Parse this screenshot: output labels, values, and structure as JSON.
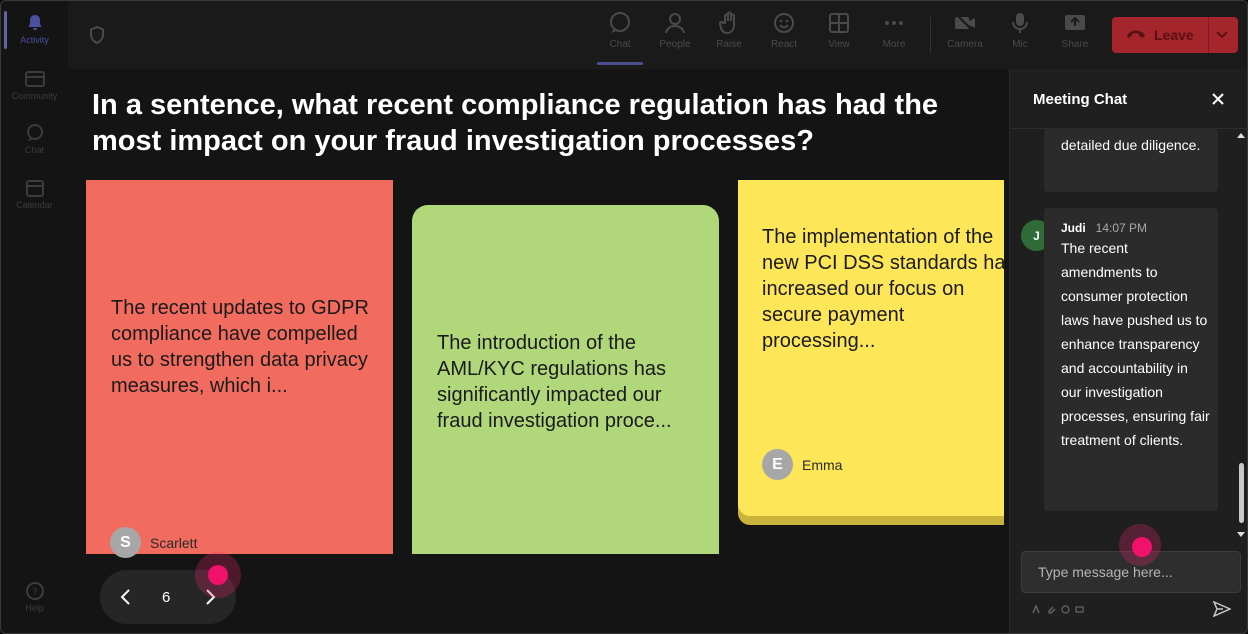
{
  "rail": {
    "items": [
      {
        "label": "Activity",
        "active": true
      },
      {
        "label": "Community"
      },
      {
        "label": "Chat"
      },
      {
        "label": "Calendar"
      }
    ],
    "help": "Help"
  },
  "toolbar": {
    "chat": "Chat",
    "people": "People",
    "raise": "Raise",
    "react": "React",
    "view": "View",
    "more": "More",
    "camera": "Camera",
    "mic": "Mic",
    "share": "Share",
    "leave": "Leave"
  },
  "stage": {
    "question": "In a sentence, what recent compliance regulation has had the most impact on your fraud investigation processes?",
    "cards": [
      {
        "text": "The recent updates to GDPR compliance have compelled us to strengthen data privacy measures, which i...",
        "author": "Scarlett",
        "initial": "S",
        "color": "#f26b5f"
      },
      {
        "text": "The introduction of the AML/KYC regulations has significantly impacted our fraud investigation proce...",
        "color": "#b0d77a"
      },
      {
        "text": "The implementation of the new PCI DSS standards has increased our focus on secure payment processing...",
        "author": "Emma",
        "initial": "E",
        "color": "#fee659"
      }
    ],
    "pager": {
      "page": "6"
    }
  },
  "chat": {
    "title": "Meeting Chat",
    "messages": [
      {
        "text": "detailed due diligence."
      },
      {
        "author": "Judi",
        "initial": "J",
        "time": "14:07 PM",
        "text": "The recent amendments to consumer protection laws have pushed us to enhance transparency and accountability in our investigation processes, ensuring fair treatment of clients."
      }
    ],
    "input_placeholder": "Type message here..."
  },
  "colors": {
    "accent": "#6264a7",
    "leave": "#a4262c",
    "cursor": "#f0116a"
  }
}
